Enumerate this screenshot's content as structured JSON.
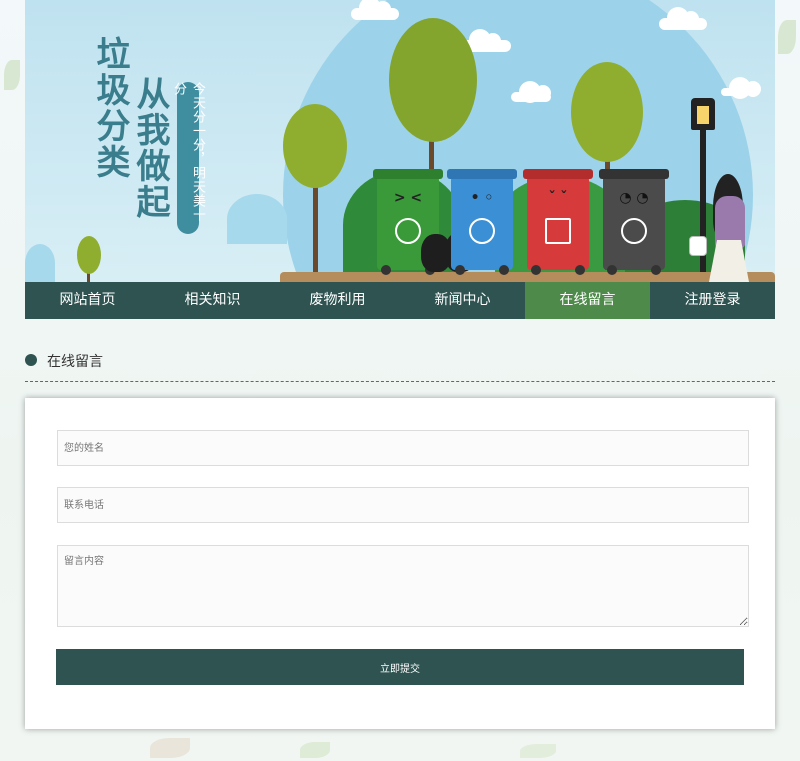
{
  "banner": {
    "title_col1": "垃圾分类",
    "title_col2": "从我做起",
    "slogan": "今天分一分，明天美十分"
  },
  "nav": {
    "items": [
      {
        "label": "网站首页"
      },
      {
        "label": "相关知识"
      },
      {
        "label": "废物利用"
      },
      {
        "label": "新闻中心"
      },
      {
        "label": "在线留言",
        "active": true
      },
      {
        "label": "注册登录"
      }
    ]
  },
  "section": {
    "title": "在线留言"
  },
  "form": {
    "name_placeholder": "您的姓名",
    "phone_placeholder": "联系电话",
    "message_placeholder": "留言内容",
    "submit_label": "立即提交"
  },
  "colors": {
    "nav_bg": "#2e5350",
    "nav_active": "#4e8a4a",
    "bin_recyclable": "#3a9a3a",
    "bin_kitchen": "#3b8fd4",
    "bin_hazardous": "#d63a3a",
    "bin_other": "#4b4b4b"
  }
}
